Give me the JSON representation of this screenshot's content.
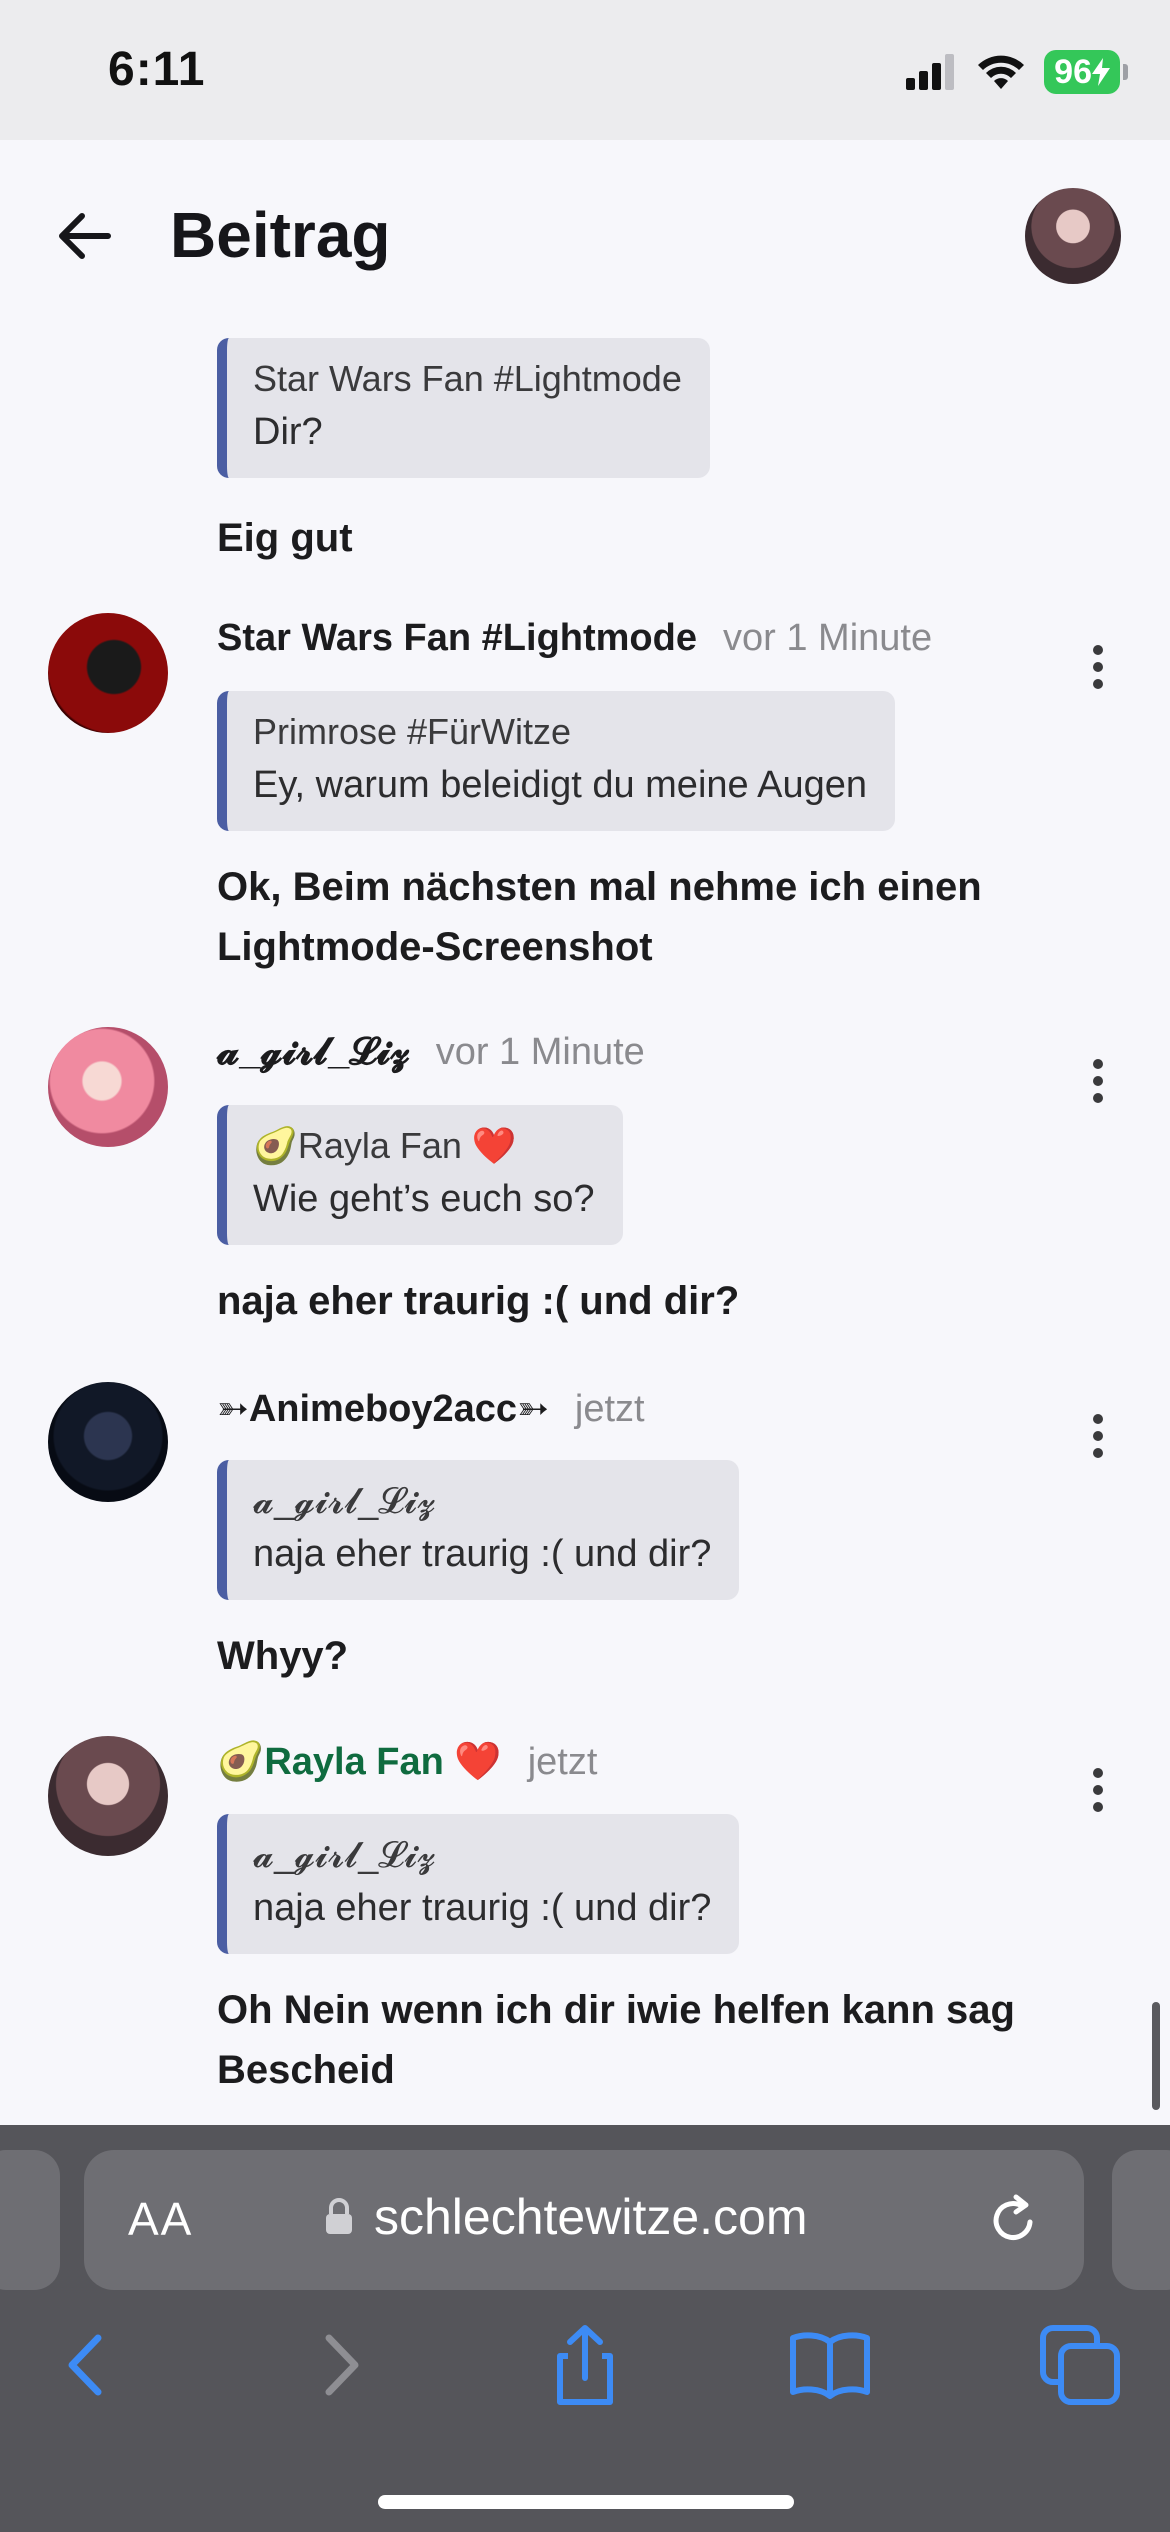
{
  "status_bar": {
    "time": "6:11",
    "battery": "96"
  },
  "header": {
    "title": "Beitrag"
  },
  "posts": [
    {
      "quote_author": "Star Wars Fan #Lightmode",
      "quote_text": "Dir?",
      "body": "Eig gut"
    },
    {
      "author": "Star Wars Fan #Lightmode",
      "time": "vor 1 Minute",
      "quote_author": "Primrose #FürWitze",
      "quote_text": "Ey, warum beleidigt du meine Augen",
      "body": "Ok, Beim nächsten mal nehme ich einen Lightmode-Screenshot"
    },
    {
      "author": "𝓪_𝓰𝓲𝓻𝓵_𝓛𝓲𝔃",
      "time": "vor 1 Minute",
      "quote_author": "🥑Rayla Fan ❤️",
      "quote_text": "Wie geht’s euch so?",
      "body": "naja eher traurig :( und dir?"
    },
    {
      "author": "➳Animeboy2acc➳",
      "time": "jetzt",
      "quote_author": "𝓪_𝓰𝓲𝓻𝓵_𝓛𝓲𝔃",
      "quote_text": "naja eher traurig :( und dir?",
      "body": "Whyy?"
    },
    {
      "author": "🥑Rayla Fan ❤️",
      "time": "jetzt",
      "quote_author": "𝓪_𝓰𝓲𝓻𝓵_𝓛𝓲𝔃",
      "quote_text": "naja eher traurig :( und dir?",
      "body": "Oh Nein wenn ich dir iwie helfen kann sag Bescheid"
    }
  ],
  "browser": {
    "text_size_label": "AA",
    "url": "schlechtewitze.com"
  },
  "colors": {
    "quote_bar": "#4b5ea3",
    "battery": "#34c759",
    "highlight_author": "#0f6b3f"
  },
  "icons": {
    "back": "arrow-left-icon",
    "menu": "vertical-dots-icon",
    "lock": "lock-icon",
    "reload": "reload-icon",
    "nav": [
      "chevron-left-icon",
      "chevron-right-icon",
      "share-icon",
      "bookmarks-icon",
      "tabs-icon"
    ]
  }
}
